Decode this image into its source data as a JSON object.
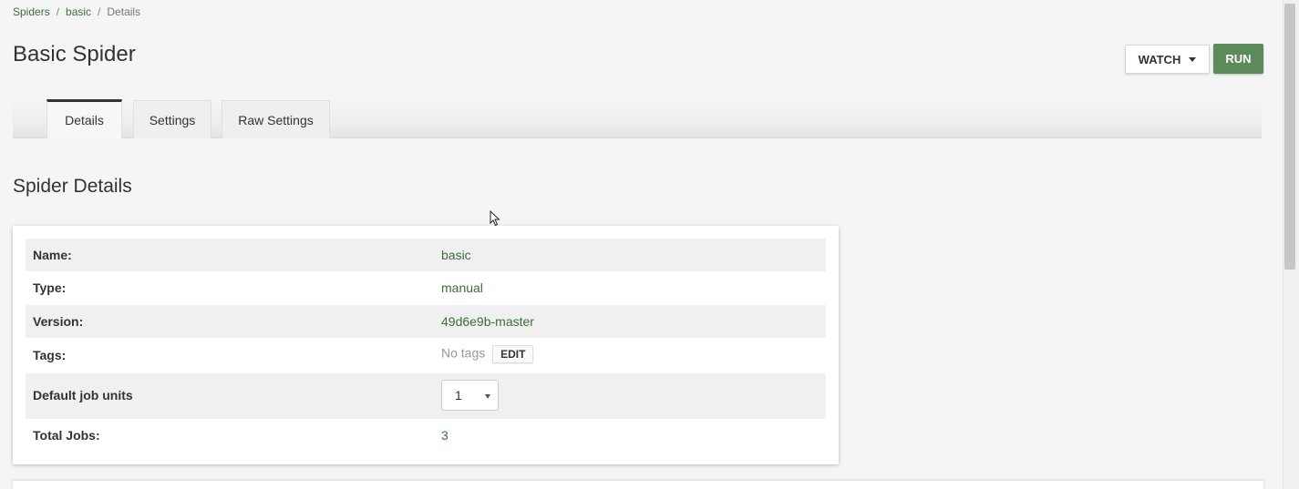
{
  "breadcrumb": {
    "items": [
      "Spiders",
      "basic",
      "Details"
    ],
    "separator": "/"
  },
  "page": {
    "title": "Basic Spider"
  },
  "actions": {
    "watch_label": "WATCH",
    "run_label": "RUN"
  },
  "tabs": [
    {
      "label": "Details",
      "active": true
    },
    {
      "label": "Settings",
      "active": false
    },
    {
      "label": "Raw Settings",
      "active": false
    }
  ],
  "section": {
    "title": "Spider Details"
  },
  "details": {
    "name_label": "Name:",
    "name_value": "basic",
    "type_label": "Type:",
    "type_value": "manual",
    "version_label": "Version:",
    "version_value": "49d6e9b-master",
    "tags_label": "Tags:",
    "tags_value": "No tags",
    "tags_edit_label": "EDIT",
    "units_label": "Default job units",
    "units_value": "1",
    "jobs_label": "Total Jobs:",
    "jobs_value": "3"
  },
  "colors": {
    "accent_green": "#5b8a5b",
    "link_green": "#3b6e3b"
  }
}
